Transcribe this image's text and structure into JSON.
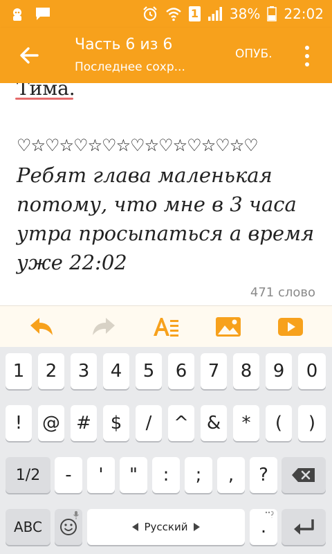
{
  "status_bar": {
    "sim_number": "1",
    "battery": "38%",
    "time": "22:02",
    "icons": [
      "app-notification-icon",
      "message-icon",
      "alarm-icon",
      "wifi-icon",
      "signal-icon",
      "battery-icon"
    ]
  },
  "app_bar": {
    "title": "Часть 6 из 6",
    "subtitle": "Последнее сохр...",
    "publish_label": "ОПУБ."
  },
  "editor": {
    "previous_word": "Тима.",
    "decoration": "♡☆♡☆♡☆♡☆♡☆♡☆♡☆♡☆♡",
    "lines": [
      "Ребят глава маленькая",
      "потому, что мне в 3 часа",
      "утра просыпаться а время",
      "уже 22:02"
    ],
    "word_count": "471 слово"
  },
  "toolbar": {
    "accent": "#f7a11c",
    "buttons": [
      "undo-icon",
      "redo-icon",
      "text-format-icon",
      "insert-image-icon",
      "insert-video-icon"
    ]
  },
  "keyboard": {
    "row1": [
      "1",
      "2",
      "3",
      "4",
      "5",
      "6",
      "7",
      "8",
      "9",
      "0"
    ],
    "row2": [
      "!",
      "@",
      "#",
      "$",
      "/",
      "^",
      "&",
      "*",
      "(",
      ")"
    ],
    "row3": {
      "toggle": "1/2",
      "keys": [
        "-",
        "'",
        "\"",
        ":",
        ";",
        ",",
        "?"
      ]
    },
    "row4": {
      "abc": "ABC",
      "space": "Русский",
      "period": "."
    }
  }
}
